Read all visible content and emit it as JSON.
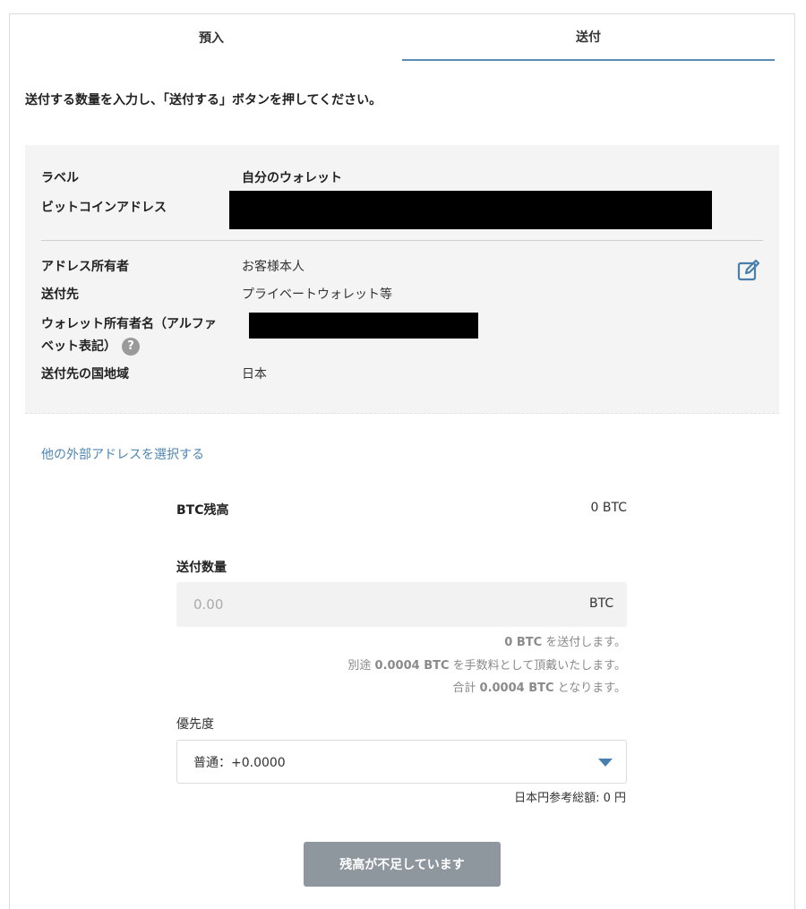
{
  "tabs": {
    "deposit": "預入",
    "send": "送付"
  },
  "instruction": "送付する数量を入力し、「送付する」ボタンを押してください。",
  "destination": {
    "label_key": "ラベル",
    "label_value": "自分のウォレット",
    "address_key": "ビットコインアドレス",
    "owner_key": "アドレス所有者",
    "owner_value": "お客様本人",
    "send_to_key": "送付先",
    "send_to_value": "プライベートウォレット等",
    "wallet_owner_name_key_line1": "ウォレット所有者名（アルファ",
    "wallet_owner_name_key_line2": "ベット表記）",
    "help_icon_glyph": "?",
    "country_key": "送付先の国地域",
    "country_value": "日本"
  },
  "other_address_link": "他の外部アドレスを選択する",
  "balance": {
    "label": "BTC残高",
    "value": "0 BTC"
  },
  "amount": {
    "label": "送付数量",
    "placeholder": "0.00",
    "unit": "BTC"
  },
  "notes": {
    "send_amount": "0 BTC",
    "send_suffix": " を送付します。",
    "fee_prefix": "別途 ",
    "fee_amount": "0.0004 BTC",
    "fee_suffix": " を手数料として頂戴いたします。",
    "total_prefix": "合計 ",
    "total_amount": "0.0004 BTC",
    "total_suffix": " となります。"
  },
  "priority": {
    "label": "優先度",
    "selected": "普通：+0.0000"
  },
  "jpy_reference": "日本円参考総額: 0 円",
  "submit_button": "残高が不足しています",
  "colors": {
    "accent": "#5a8db3",
    "link": "#4f86b2",
    "disabled_button": "#8e969e"
  }
}
